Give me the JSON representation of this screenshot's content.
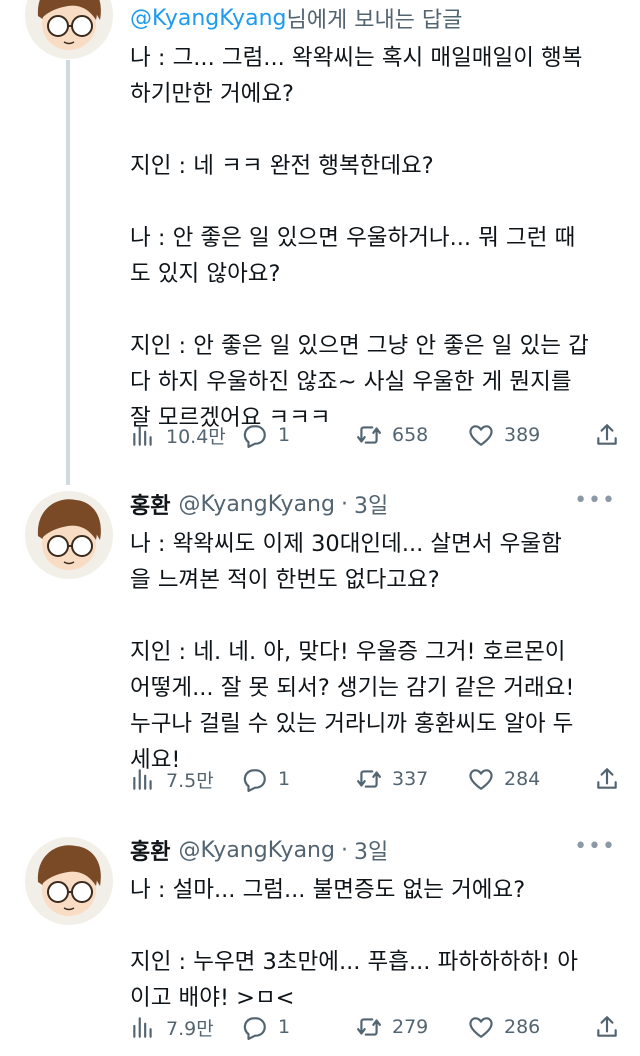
{
  "tweets": [
    {
      "reply_prefix": "",
      "reply_handle": "@KyangKyang",
      "reply_suffix": " 님에게 보내는 답글",
      "body": "나 : 그... 그럼... 왁왁씨는 혹시 매일매일이 행복\n하기만한 거에요?\n\n지인 : 네 ㅋㅋ 완전 행복한데요?\n\n나 : 안 좋은 일 있으면 우울하거나... 뭐 그런 때\n도 있지 않아요?\n\n지인 : 안 좋은 일 있으면 그냥 안 좋은 일 있는 갑\n다 하지 우울하진 않죠~ 사실 우울한 게 뭔지를\n잘 모르겠어요 ㅋㅋㅋ",
      "views": "10.4만",
      "replies": "1",
      "retweets": "658",
      "likes": "389"
    },
    {
      "name": "홍환",
      "handle": "@KyangKyang",
      "time": "3일",
      "body": "나 : 왁왁씨도 이제 30대인데... 살면서 우울함\n을 느껴본 적이 한번도 없다고요?\n\n지인 : 네. 네. 아, 맞다! 우울증 그거! 호르몬이\n어떻게... 잘 못 되서? 생기는 감기 같은 거래요!\n누구나 걸릴 수 있는 거라니까 홍환씨도 알아 두\n세요!",
      "views": "7.5만",
      "replies": "1",
      "retweets": "337",
      "likes": "284"
    },
    {
      "name": "홍환",
      "handle": "@KyangKyang",
      "time": "3일",
      "body": "나 : 설마... 그럼... 불면증도 없는 거에요?\n\n지인 : 누우면 3초만에... 푸흡... 파하하하하! 아\n이고 배야! >ㅁ<",
      "views": "7.9만",
      "replies": "1",
      "retweets": "279",
      "likes": "286"
    }
  ],
  "icons": {
    "views": "bar-chart-icon",
    "reply": "speech-bubble-icon",
    "retweet": "retweet-icon",
    "like": "heart-icon",
    "share": "share-icon",
    "more": "more-dots-icon"
  },
  "colors": {
    "text": "#0f1419",
    "secondary": "#536471",
    "link": "#1d9bf0",
    "thread_line": "#cfd9de"
  }
}
